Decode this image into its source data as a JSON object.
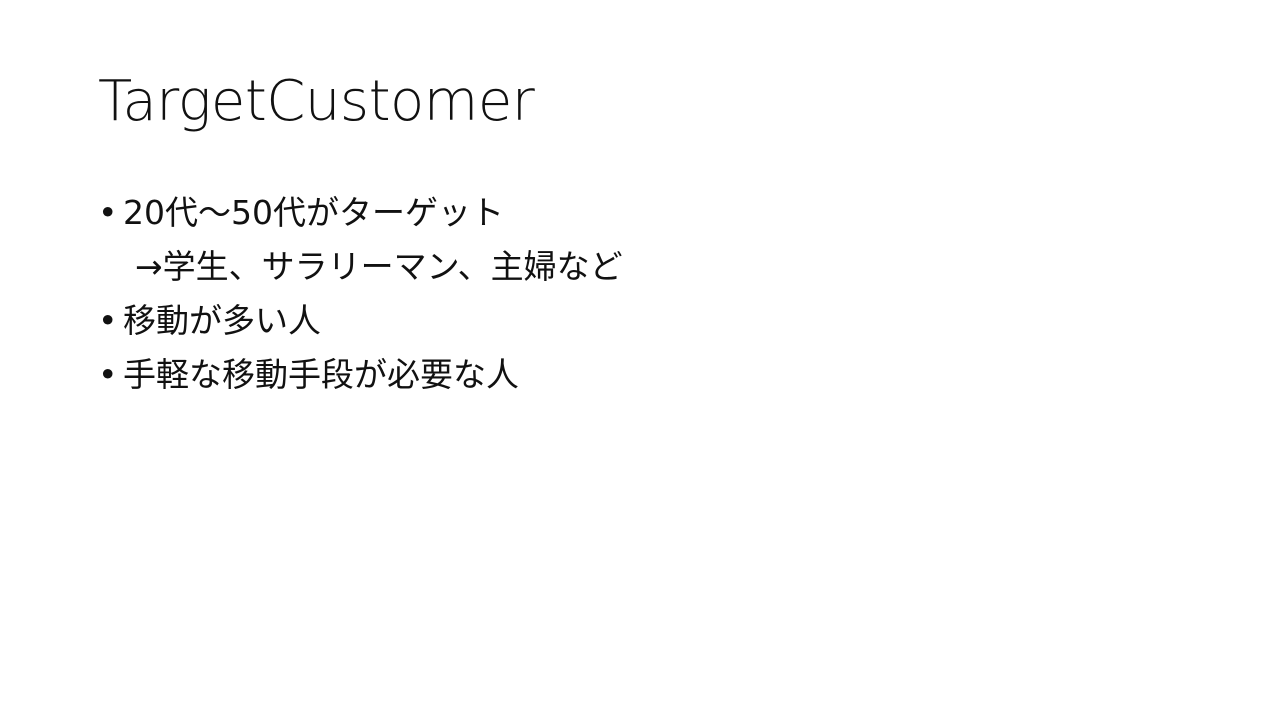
{
  "slide": {
    "title": "TargetCustomer",
    "bullets": [
      {
        "text": "20代～50代がターゲット",
        "subtext": "→学生、サラリーマン、主婦など"
      },
      {
        "text": "移動が多い人"
      },
      {
        "text": "手軽な移動手段が必要な人"
      }
    ],
    "bullet_marker": "•"
  }
}
